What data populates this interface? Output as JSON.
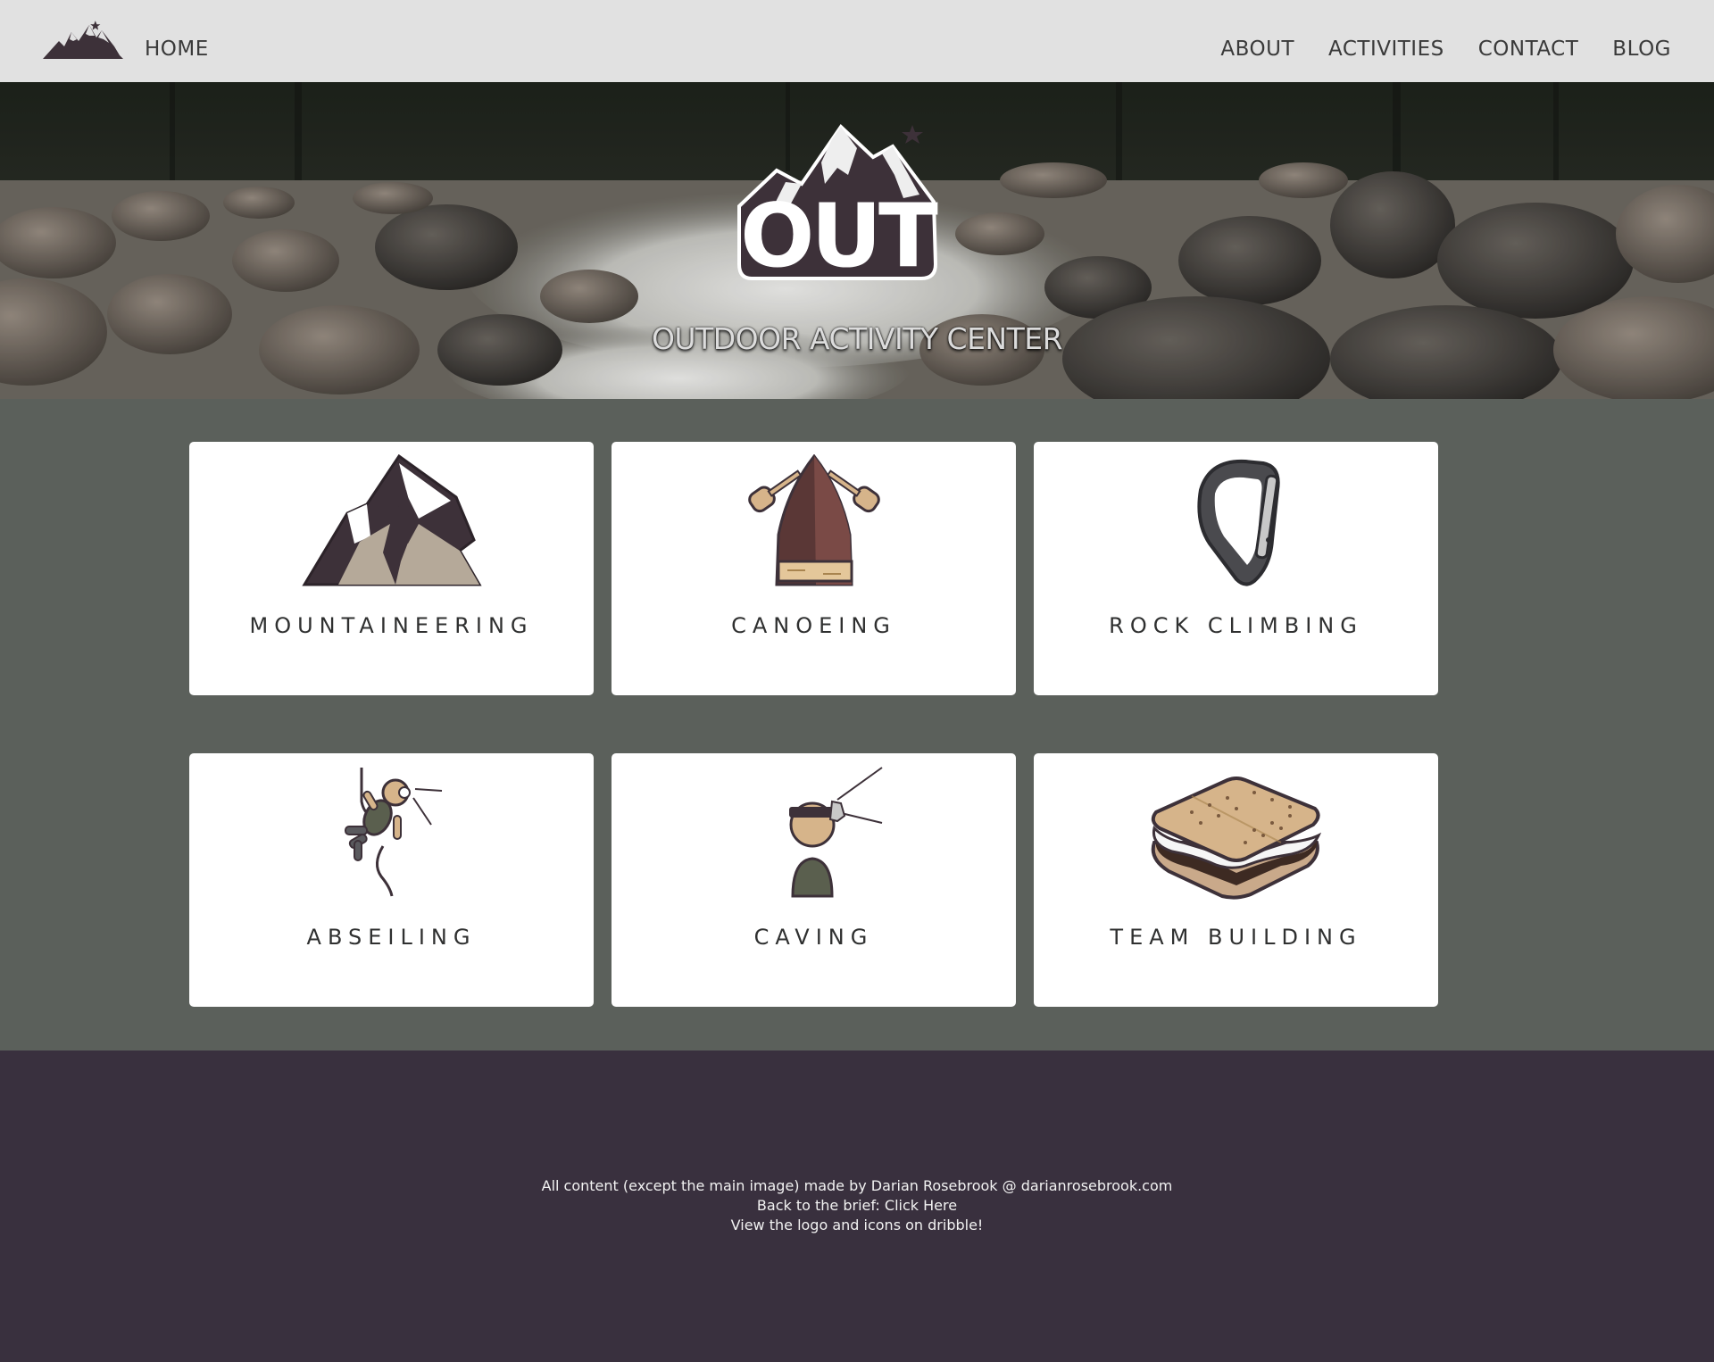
{
  "nav": {
    "home_label": "HOME",
    "links": [
      "ABOUT",
      "ACTIVITIES",
      "CONTACT",
      "BLOG"
    ]
  },
  "hero": {
    "logo_text": "OUT",
    "subtitle": "OUTDOOR ACTIVITY CENTER"
  },
  "activities": [
    {
      "label": "MOUNTAINEERING",
      "icon": "mountain-icon"
    },
    {
      "label": "CANOEING",
      "icon": "canoe-icon"
    },
    {
      "label": "ROCK CLIMBING",
      "icon": "carabiner-icon"
    },
    {
      "label": "ABSEILING",
      "icon": "abseiler-icon"
    },
    {
      "label": "CAVING",
      "icon": "caver-icon"
    },
    {
      "label": "TEAM BUILDING",
      "icon": "smore-icon"
    }
  ],
  "footer": {
    "credit_line": "All content (except the main image) made by Darian Rosebrook @ darianrosebrook.com",
    "brief_link": "Back to the brief: Click Here",
    "dribble_link": "View the logo and icons on dribble!"
  },
  "colors": {
    "nav_bg": "#e1e1e1",
    "section_bg": "#5b605b",
    "footer_bg": "#39303e",
    "logo_purple": "#3d3139",
    "card_bg": "#ffffff"
  }
}
